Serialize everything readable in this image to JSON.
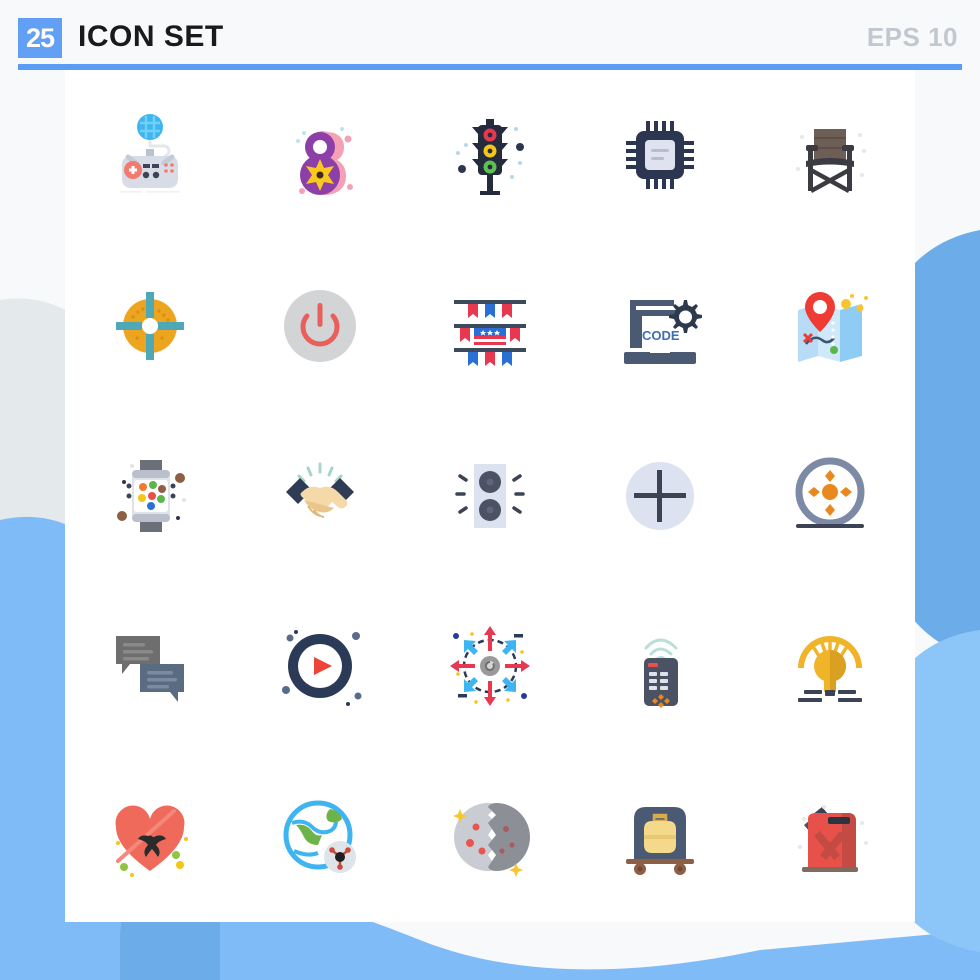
{
  "header": {
    "badge_count": "25",
    "title": "ICON SET",
    "format_label": "EPS 10",
    "accent_color": "#5b9cf6",
    "badge_bg": "#61a0f5",
    "title_color": "#1a1a1a",
    "format_color": "#c2c8cf"
  },
  "background": {
    "page_bg": "#f7f9fb",
    "card_bg": "#ffffff",
    "blob_blue": "#6cace9",
    "blob_blue_light": "#7fbcf7",
    "blob_gray": "#e4e9ec"
  },
  "grid": {
    "columns": 5,
    "rows": 5,
    "total_icons": 25
  },
  "icons": [
    {
      "id": 1,
      "name": "game-controller-icon",
      "label": "Game Controller",
      "row": 1,
      "col": 1,
      "colors": [
        "#3eb5f1",
        "#d7dce6",
        "#f4796f"
      ]
    },
    {
      "id": 2,
      "name": "womens-day-icon",
      "label": "Women's Day 8",
      "row": 1,
      "col": 2,
      "colors": [
        "#8d3fa8",
        "#f9c81f",
        "#f9a8b8"
      ]
    },
    {
      "id": 3,
      "name": "traffic-light-icon",
      "label": "Traffic Light",
      "row": 1,
      "col": 3,
      "colors": [
        "#232b3d",
        "#e8384f",
        "#f5c518",
        "#4caf50"
      ]
    },
    {
      "id": 4,
      "name": "processor-chip-icon",
      "label": "Processor Chip",
      "row": 1,
      "col": 4,
      "colors": [
        "#2d3651",
        "#dfe3ef"
      ]
    },
    {
      "id": 5,
      "name": "director-chair-icon",
      "label": "Director Chair",
      "row": 1,
      "col": 5,
      "colors": [
        "#6e5f56",
        "#3b3b42"
      ]
    },
    {
      "id": 6,
      "name": "target-crosshair-icon",
      "label": "Target",
      "row": 2,
      "col": 1,
      "colors": [
        "#eda51f",
        "#4fa8b8"
      ]
    },
    {
      "id": 7,
      "name": "power-button-icon",
      "label": "Power Button",
      "row": 2,
      "col": 2,
      "colors": [
        "#d2d4d6",
        "#e8605c"
      ]
    },
    {
      "id": 8,
      "name": "flag-bunting-icon",
      "label": "Flag Bunting",
      "row": 2,
      "col": 3,
      "colors": [
        "#e8384f",
        "#2a6fd6",
        "#3b4a5c"
      ]
    },
    {
      "id": 9,
      "name": "code-laptop-icon",
      "label": "Code",
      "row": 2,
      "col": 4,
      "text": "CODE",
      "colors": [
        "#4a5a72",
        "#2d3a4d"
      ]
    },
    {
      "id": 10,
      "name": "map-location-icon",
      "label": "Map Location",
      "row": 2,
      "col": 5,
      "colors": [
        "#b8dcf7",
        "#8ecbf5",
        "#ef3b33",
        "#f7c62e"
      ]
    },
    {
      "id": 11,
      "name": "smartwatch-icon",
      "label": "Smart Watch",
      "row": 3,
      "col": 1,
      "colors": [
        "#dfe3ea",
        "#6b6f78",
        "#8d6046"
      ]
    },
    {
      "id": 12,
      "name": "handshake-icon",
      "label": "Handshake",
      "row": 3,
      "col": 2,
      "colors": [
        "#f5d9a8",
        "#2f3c55",
        "#a8d5cb"
      ]
    },
    {
      "id": 13,
      "name": "speaker-icon",
      "label": "Speaker",
      "row": 3,
      "col": 3,
      "colors": [
        "#dde2f0",
        "#4a5264"
      ]
    },
    {
      "id": 14,
      "name": "add-plus-icon",
      "label": "Add",
      "row": 3,
      "col": 4,
      "colors": [
        "#dde2f0",
        "#3b4354"
      ]
    },
    {
      "id": 15,
      "name": "film-reel-icon",
      "label": "Film Reel",
      "row": 3,
      "col": 5,
      "colors": [
        "#7d8aa5",
        "#e8881f",
        "#3b4354"
      ]
    },
    {
      "id": 16,
      "name": "chat-bubbles-icon",
      "label": "Chat",
      "row": 4,
      "col": 1,
      "colors": [
        "#6e6e6e",
        "#5a6b82"
      ]
    },
    {
      "id": 17,
      "name": "play-button-icon",
      "label": "Play",
      "row": 4,
      "col": 2,
      "colors": [
        "#2b3a57",
        "#ee4337",
        "#5a6b8a"
      ]
    },
    {
      "id": 18,
      "name": "expand-arrows-icon",
      "label": "Expand",
      "row": 4,
      "col": 3,
      "colors": [
        "#e8384f",
        "#3eb5f1",
        "#2b3a57",
        "#9a9a9a"
      ]
    },
    {
      "id": 19,
      "name": "tv-remote-icon",
      "label": "Remote Control",
      "row": 4,
      "col": 4,
      "colors": [
        "#4a5264",
        "#b8e0d8",
        "#e8881f"
      ]
    },
    {
      "id": 20,
      "name": "light-bulb-icon",
      "label": "Idea Bulb",
      "row": 4,
      "col": 5,
      "colors": [
        "#f0b429",
        "#c99a1e",
        "#3b4354"
      ]
    },
    {
      "id": 21,
      "name": "heart-arrow-icon",
      "label": "Heart Arrow",
      "row": 5,
      "col": 1,
      "colors": [
        "#ef6a5a",
        "#2b2b2b",
        "#8dc63f"
      ]
    },
    {
      "id": 22,
      "name": "earth-molecule-icon",
      "label": "Earth Science",
      "row": 5,
      "col": 2,
      "colors": [
        "#3eb5f1",
        "#6cb44a",
        "#dfe3ea",
        "#1f1f1f"
      ]
    },
    {
      "id": 23,
      "name": "cracked-rock-icon",
      "label": "Cracked Rock",
      "row": 5,
      "col": 3,
      "colors": [
        "#c9ccd2",
        "#8c9096",
        "#e8554e",
        "#f7c62e"
      ]
    },
    {
      "id": 24,
      "name": "luggage-cart-icon",
      "label": "Luggage Cart",
      "row": 5,
      "col": 4,
      "colors": [
        "#4a5a72",
        "#f5d98a",
        "#8d6046"
      ]
    },
    {
      "id": 25,
      "name": "fuel-can-icon",
      "label": "Fuel Can",
      "row": 5,
      "col": 5,
      "colors": [
        "#e8504a",
        "#c44a44",
        "#3b4354",
        "#7d6b60"
      ]
    }
  ]
}
